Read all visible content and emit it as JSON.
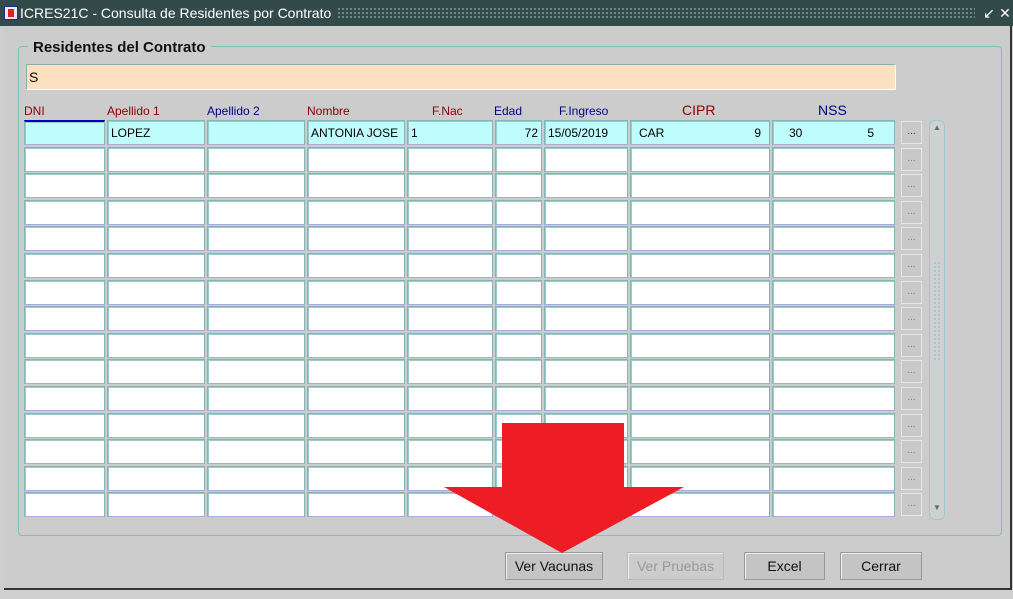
{
  "window": {
    "title": "ICRES21C - Consulta de Residentes por Contrato"
  },
  "section": {
    "title": "Residentes del Contrato",
    "contract_value": "S"
  },
  "columns": [
    {
      "label": "DNI",
      "color": "#8b0000"
    },
    {
      "label": "Apellido 1",
      "color": "#8b0000"
    },
    {
      "label": "Apellido 2",
      "color": "#000080"
    },
    {
      "label": "Nombre",
      "color": "#8b0000"
    },
    {
      "label": "F.Nac",
      "color": "#8b0000"
    },
    {
      "label": "Edad",
      "color": "#000080"
    },
    {
      "label": "F.Ingreso",
      "color": "#000080"
    },
    {
      "label": "CIPR",
      "color": "#8b0000"
    },
    {
      "label": "NSS",
      "color": "#000080"
    }
  ],
  "rows": [
    {
      "dni": "",
      "apellido1": "LOPEZ",
      "apellido2": "",
      "nombre": "ANTONIA JOSE",
      "fnac": "1",
      "edad": "72",
      "fingreso": "15/05/2019",
      "cipr_prefix": "CAR",
      "cipr_suffix": "9",
      "nss_prefix": "30",
      "nss_suffix": "5"
    }
  ],
  "row_button_label": "...",
  "buttons": {
    "ver_vacunas": "Ver Vacunas",
    "ver_pruebas": "Ver Pruebas",
    "excel": "Excel",
    "cerrar": "Cerrar"
  },
  "annotation": {
    "arrow_color": "#ee1c25"
  }
}
